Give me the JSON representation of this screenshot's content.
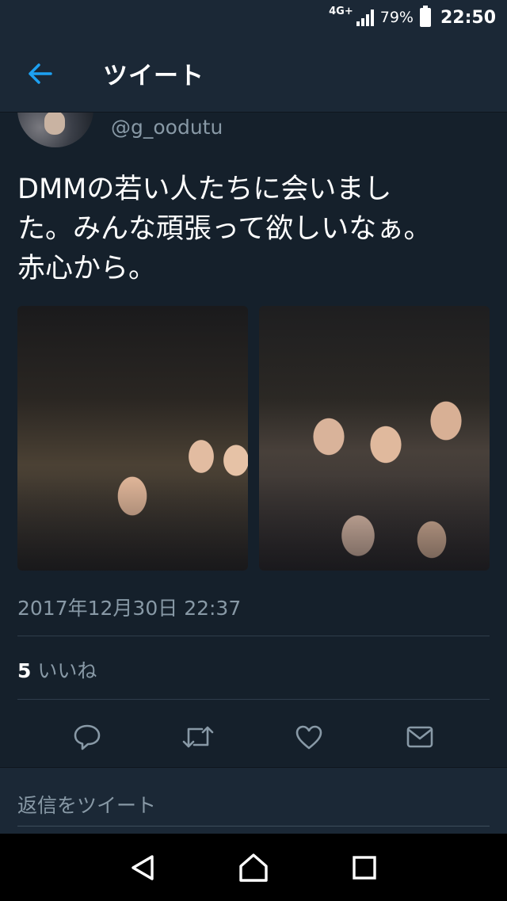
{
  "status_bar": {
    "network": "4G+",
    "battery": "79%",
    "time": "22:50"
  },
  "header": {
    "title": "ツイート"
  },
  "tweet": {
    "handle": "@g_oodutu",
    "text": "DMMの若い人たちに会いまし\nた。みんな頑張って欲しいなぁ。\n赤心から。",
    "timestamp": "2017年12月30日 22:37",
    "likes_count": "5",
    "likes_label": "いいね"
  },
  "reply": {
    "placeholder": "返信をツイート"
  },
  "icons": [
    "back-arrow-icon",
    "reply-icon",
    "retweet-icon",
    "like-heart-icon",
    "direct-message-icon",
    "nav-back-icon",
    "nav-home-icon",
    "nav-recents-icon"
  ],
  "colors": {
    "accent": "#1da1f2",
    "background": "#15202b",
    "bar": "#1b2836",
    "secondary_text": "#8899a6"
  }
}
